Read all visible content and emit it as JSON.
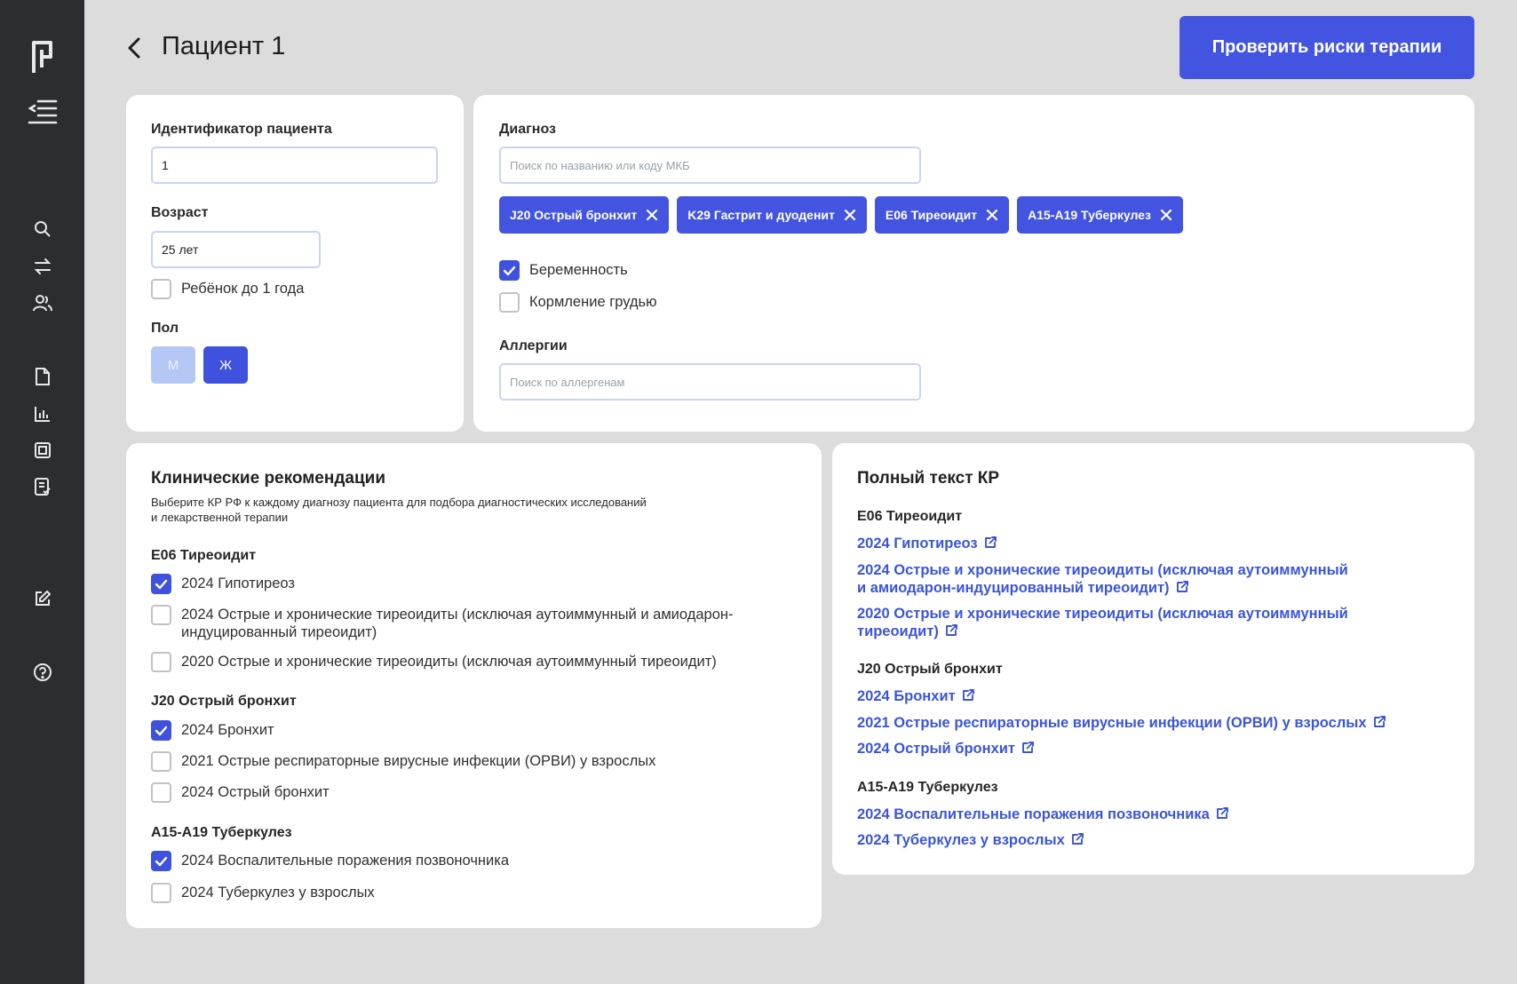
{
  "header": {
    "title": "Пациент 1",
    "check_button": "Проверить риски терапии"
  },
  "colors": {
    "accent": "#4355e0",
    "sidebar": "#2c2d31",
    "link": "#3b55d9"
  },
  "sidebar": {
    "icons": [
      "logo-icon",
      "menu-collapse-icon",
      "search-icon",
      "swap-icon",
      "users-icon",
      "document-icon",
      "chart-icon",
      "image-icon",
      "report-icon",
      "edit-icon",
      "help-icon"
    ]
  },
  "patient": {
    "id_label": "Идентификатор пациента",
    "id_value": "1",
    "age_label": "Возраст",
    "age_value": "25 лет",
    "infant_label": "Ребёнок до 1 года",
    "infant_checked": false,
    "sex_label": "Пол",
    "sex_m": "М",
    "sex_f": "Ж",
    "sex_selected": "Ж"
  },
  "diagnosis": {
    "label": "Диагноз",
    "search_placeholder": "Поиск по названию или коду МКБ",
    "tags": [
      "J20 Острый бронхит",
      "K29 Гастрит и дуоденит",
      "E06 Тиреоидит",
      "A15-A19 Туберкулез"
    ],
    "pregnancy_label": "Беременность",
    "pregnancy_checked": true,
    "breastfeeding_label": "Кормление грудью",
    "breastfeeding_checked": false,
    "allergy_label": "Аллергии",
    "allergy_placeholder": "Поиск по аллергенам"
  },
  "recommendations": {
    "title": "Клинические рекомендации",
    "subtitle_line1": "Выберите КР РФ к каждому диагнозу пациента для подбора диагностических исследований",
    "subtitle_line2": "и лекарственной терапии",
    "groups": [
      {
        "name": "E06 Тиреоидит",
        "items": [
          {
            "label": "2024 Гипотиреоз",
            "checked": true
          },
          {
            "label": "2024 Острые и хронические тиреоидиты (исключая аутоиммунный и амиодарон-",
            "label2": "индуцированный тиреоидит)",
            "checked": false
          },
          {
            "label": "2020 Острые и хронические тиреоидиты (исключая аутоиммунный тиреоидит)",
            "checked": false
          }
        ]
      },
      {
        "name": "J20 Острый бронхит",
        "items": [
          {
            "label": "2024 Бронхит",
            "checked": true
          },
          {
            "label": "2021 Острые респираторные вирусные инфекции (ОРВИ) у взрослых",
            "checked": false
          },
          {
            "label": "2024 Острый бронхит",
            "checked": false
          }
        ]
      },
      {
        "name": "A15-A19 Туберкулез",
        "items": [
          {
            "label": "2024 Воспалительные поражения позвоночника",
            "checked": true
          },
          {
            "label": "2024 Туберкулез у взрослых",
            "checked": false
          }
        ]
      }
    ]
  },
  "fulltext": {
    "title": "Полный текст КР",
    "groups": [
      {
        "name": "E06 Тиреоидит",
        "links": [
          {
            "line1": "2024 Гипотиреоз"
          },
          {
            "line1": "2024 Острые и хронические тиреоидиты (исключая аутоиммунный",
            "line2": "и амиодарон-индуцированный тиреоидит)"
          },
          {
            "line1": "2020 Острые и хронические тиреоидиты (исключая аутоиммунный",
            "line2": "тиреоидит)"
          }
        ]
      },
      {
        "name": "J20 Острый бронхит",
        "links": [
          {
            "line1": "2024 Бронхит"
          },
          {
            "line1": "2021 Острые респираторные вирусные инфекции (ОРВИ) у взрослых"
          },
          {
            "line1": "2024 Острый бронхит"
          }
        ]
      },
      {
        "name": "A15-A19 Туберкулез",
        "links": [
          {
            "line1": "2024 Воспалительные поражения позвоночника"
          },
          {
            "line1": "2024 Туберкулез у взрослых"
          }
        ]
      }
    ]
  }
}
